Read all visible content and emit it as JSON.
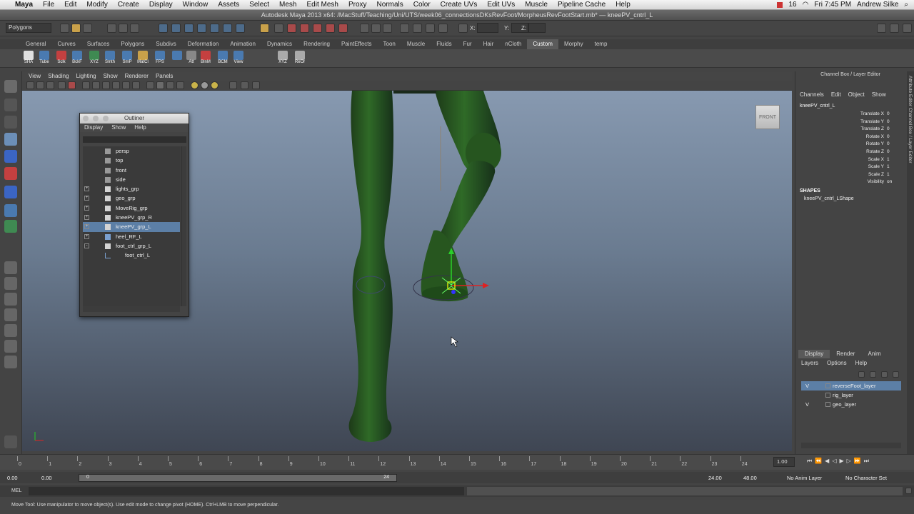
{
  "mac_menu": {
    "items": [
      "Maya",
      "File",
      "Edit",
      "Modify",
      "Create",
      "Display",
      "Window",
      "Assets",
      "Select",
      "Mesh",
      "Edit Mesh",
      "Proxy",
      "Normals",
      "Color",
      "Create UVs",
      "Edit UVs",
      "Muscle",
      "Pipeline Cache",
      "Help"
    ],
    "battery": "16",
    "clock": "Fri 7:45 PM",
    "user": "Andrew Silke"
  },
  "window_title": "Autodesk Maya 2013 x64: /MacStuff/Teaching/Uni/UTS/week06_connectionsDKsRevFoot/MorpheusRevFootStart.mb* — kneePV_cntrl_L",
  "toolbar": {
    "mode_dropdown": "Polygons",
    "field_x": "X:",
    "field_y": "Y:",
    "field_z": "Z:"
  },
  "shelf_tabs": [
    "General",
    "Curves",
    "Surfaces",
    "Polygons",
    "Subdivs",
    "Deformation",
    "Animation",
    "Dynamics",
    "Rendering",
    "PaintEffects",
    "Toon",
    "Muscle",
    "Fluids",
    "Fur",
    "Hair",
    "nCloth",
    "Custom",
    "Morphy",
    "temp"
  ],
  "shelf_active": "Custom",
  "shelf_buttons": [
    "SHA",
    "Tube",
    "Sclk",
    "BckF",
    "XYZ",
    "Smth",
    "SmP",
    "MatCl",
    "FPS",
    "",
    "Att",
    "BlnM",
    "BCM",
    "View",
    "XYZ",
    "ReOr"
  ],
  "viewport_menu": [
    "View",
    "Shading",
    "Lighting",
    "Show",
    "Renderer",
    "Panels"
  ],
  "view_cube_label": "FRONT",
  "outliner": {
    "title": "Outliner",
    "menu": [
      "Display",
      "Show",
      "Help"
    ],
    "items": [
      {
        "name": "persp",
        "expander": "",
        "icon": "camera-icon"
      },
      {
        "name": "top",
        "expander": "",
        "icon": "camera-icon"
      },
      {
        "name": "front",
        "expander": "",
        "icon": "camera-icon"
      },
      {
        "name": "side",
        "expander": "",
        "icon": "camera-icon"
      },
      {
        "name": "lights_grp",
        "expander": "+",
        "icon": "group-icon"
      },
      {
        "name": "geo_grp",
        "expander": "+",
        "icon": "group-icon"
      },
      {
        "name": "MoveRig_grp",
        "expander": "+",
        "icon": "group-icon"
      },
      {
        "name": "kneePV_grp_R",
        "expander": "+",
        "icon": "group-icon"
      },
      {
        "name": "kneePV_grp_L",
        "expander": "+",
        "icon": "group-icon",
        "selected": true
      },
      {
        "name": "heel_RF_L",
        "expander": "+",
        "icon": "joint-icon"
      },
      {
        "name": "foot_ctrl_grp_L",
        "expander": "-",
        "icon": "group-icon"
      },
      {
        "name": "foot_ctrl_L",
        "expander": "",
        "icon": "curve-icon",
        "indent": true
      }
    ]
  },
  "channel_box": {
    "title": "Channel Box / Layer Editor",
    "menu": [
      "Channels",
      "Edit",
      "Object",
      "Show"
    ],
    "object_name": "kneePV_cntrl_L",
    "attributes": [
      {
        "name": "Translate X",
        "value": "0"
      },
      {
        "name": "Translate Y",
        "value": "0"
      },
      {
        "name": "Translate Z",
        "value": "0"
      },
      {
        "name": "Rotate X",
        "value": "0"
      },
      {
        "name": "Rotate Y",
        "value": "0"
      },
      {
        "name": "Rotate Z",
        "value": "0"
      },
      {
        "name": "Scale X",
        "value": "1"
      },
      {
        "name": "Scale Y",
        "value": "1"
      },
      {
        "name": "Scale Z",
        "value": "1"
      },
      {
        "name": "Visibility",
        "value": "on"
      }
    ],
    "shapes_label": "SHAPES",
    "shape_name": "kneePV_cntrl_LShape",
    "side_tabs": "Attribute Editor   Channel Box / Layer Editor"
  },
  "layer_editor": {
    "tabs": [
      "Display",
      "Render",
      "Anim"
    ],
    "active_tab": "Display",
    "menu": [
      "Layers",
      "Options",
      "Help"
    ],
    "layers": [
      {
        "v": "V",
        "name": "reverseFoot_layer",
        "selected": true
      },
      {
        "v": "",
        "name": "rig_layer"
      },
      {
        "v": "V",
        "name": "geo_layer"
      }
    ]
  },
  "timeline": {
    "ticks": [
      "0",
      "1",
      "2",
      "3",
      "4",
      "5",
      "6",
      "7",
      "8",
      "9",
      "10",
      "11",
      "12",
      "13",
      "14",
      "15",
      "16",
      "17",
      "18",
      "19",
      "20",
      "21",
      "22",
      "23",
      "24"
    ],
    "current_time": "1.00"
  },
  "range": {
    "start": "0.00",
    "playback_start": "0.00",
    "slider_start": "0",
    "slider_end": "24",
    "playback_end": "24.00",
    "end": "48.00",
    "anim_layer": "No Anim Layer",
    "character_set": "No Character Set"
  },
  "command_line": {
    "label": "MEL"
  },
  "help_line": "Move Tool: Use manipulator to move object(s). Use edit mode to change pivot (HOME). Ctrl+LMB to move perpendicular.",
  "colors": {
    "selection": "#5c7fa6",
    "model": "#2c5c25",
    "viewport_top": "#8799b0"
  }
}
